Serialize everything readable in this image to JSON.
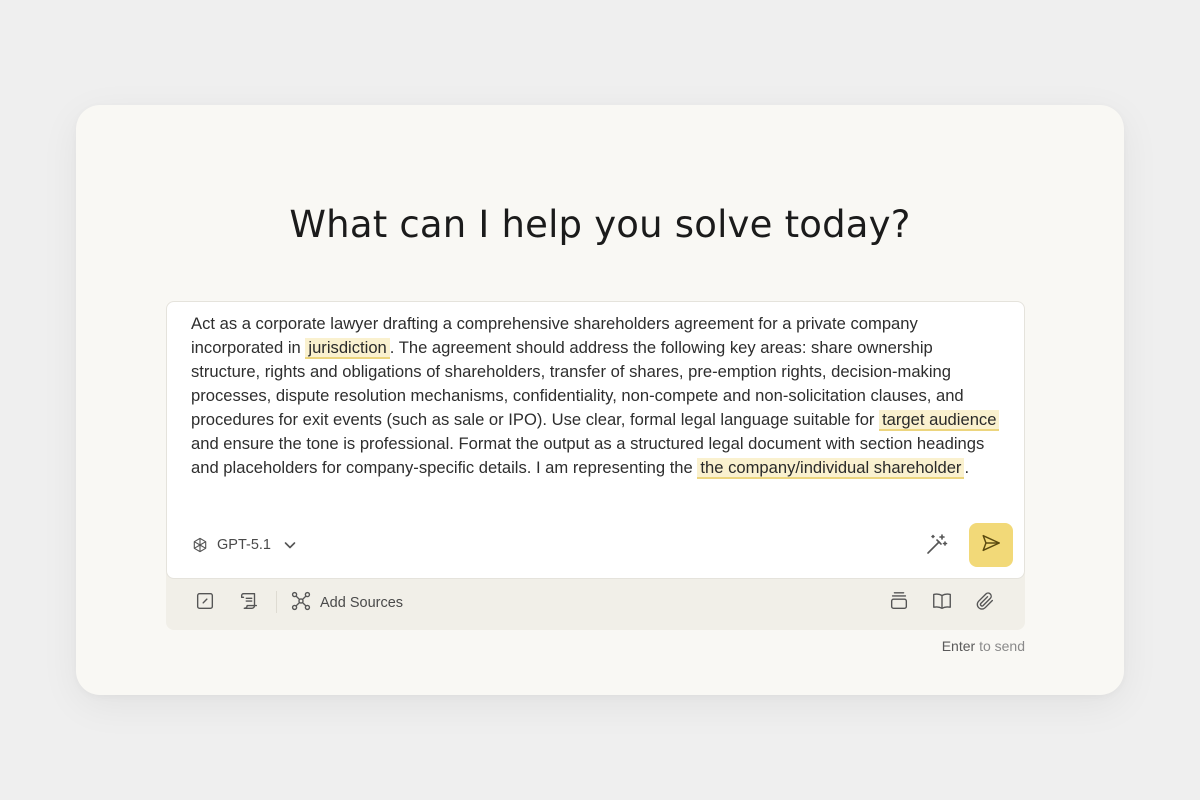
{
  "heading": "What can I help you solve today?",
  "prompt": {
    "segments": [
      {
        "text": "Act as a corporate lawyer drafting a comprehensive shareholders agreement for a private company incorporated in ",
        "variable": false
      },
      {
        "text": "jurisdiction",
        "variable": true
      },
      {
        "text": ". The agreement should address the following key areas: share ownership structure, rights and obligations of shareholders, transfer of shares, pre-emption rights, decision-making processes, dispute resolution mechanisms, confidentiality, non-compete and non-solicitation clauses, and procedures for exit events (such as sale or IPO). Use clear, formal legal language suitable for ",
        "variable": false
      },
      {
        "text": "target audience",
        "variable": true
      },
      {
        "text": " and ensure the tone is professional. Format the output as a structured legal document with section headings and placeholders for company-specific details. I am representing the ",
        "variable": false
      },
      {
        "text": "the company/individual shareholder",
        "variable": true
      },
      {
        "text": ".",
        "variable": false
      }
    ]
  },
  "composer": {
    "model": "GPT-5.1",
    "model_icon": "openai-logo-icon",
    "dropdown_icon": "chevron-down-icon",
    "enhance_icon": "magic-wand-icon",
    "send_icon": "send-icon"
  },
  "toolbar": {
    "left_icons": [
      "edit-square-icon",
      "scroll-icon"
    ],
    "add_sources_label": "Add Sources",
    "add_sources_icon": "nodes-icon",
    "right_icons": [
      "stack-icon",
      "book-open-icon",
      "paperclip-icon"
    ]
  },
  "hint": {
    "key": "Enter",
    "text": "to send"
  },
  "colors": {
    "background": "#efefef",
    "card": "#f9f8f4",
    "accent": "#f2d978",
    "highlight": "#faf1cf",
    "highlight_underline": "#ecd57e",
    "toolbar": "#f1efe8"
  }
}
